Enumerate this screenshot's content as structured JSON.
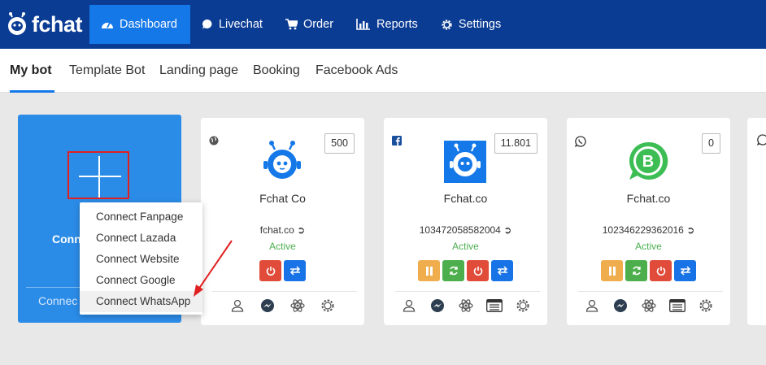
{
  "app": {
    "name": "fchat"
  },
  "nav": [
    {
      "label": "Dashboard",
      "icon": "dashboard-icon",
      "active": true
    },
    {
      "label": "Livechat",
      "icon": "chat-bubble-icon"
    },
    {
      "label": "Order",
      "icon": "cart-icon"
    },
    {
      "label": "Reports",
      "icon": "bar-chart-icon"
    },
    {
      "label": "Settings",
      "icon": "gear-icon"
    }
  ],
  "subtabs": [
    "My bot",
    "Template Bot",
    "Landing page",
    "Booking",
    "Facebook Ads"
  ],
  "create_card": {
    "label": "Conn",
    "bottom_label": "Connec"
  },
  "dropdown": [
    "Connect Fanpage",
    "Connect Lazada",
    "Connect Website",
    "Connect Google",
    "Connect WhatsApp"
  ],
  "bots": [
    {
      "platform": "web-globe-icon",
      "count": "500",
      "name": "Fchat Co",
      "id": "fchat.co",
      "status": "Active"
    },
    {
      "platform": "facebook-icon",
      "count": "11.801",
      "name": "Fchat.co",
      "id": "103472058582004",
      "status": "Active"
    },
    {
      "platform": "whatsapp-icon",
      "count": "0",
      "name": "Fchat.co",
      "id": "102346229362016",
      "status": "Active"
    }
  ],
  "colors": {
    "nav_bg": "#0b3c94",
    "accent": "#1578e8",
    "active_green": "#4caf50",
    "danger": "#e04b3a"
  }
}
